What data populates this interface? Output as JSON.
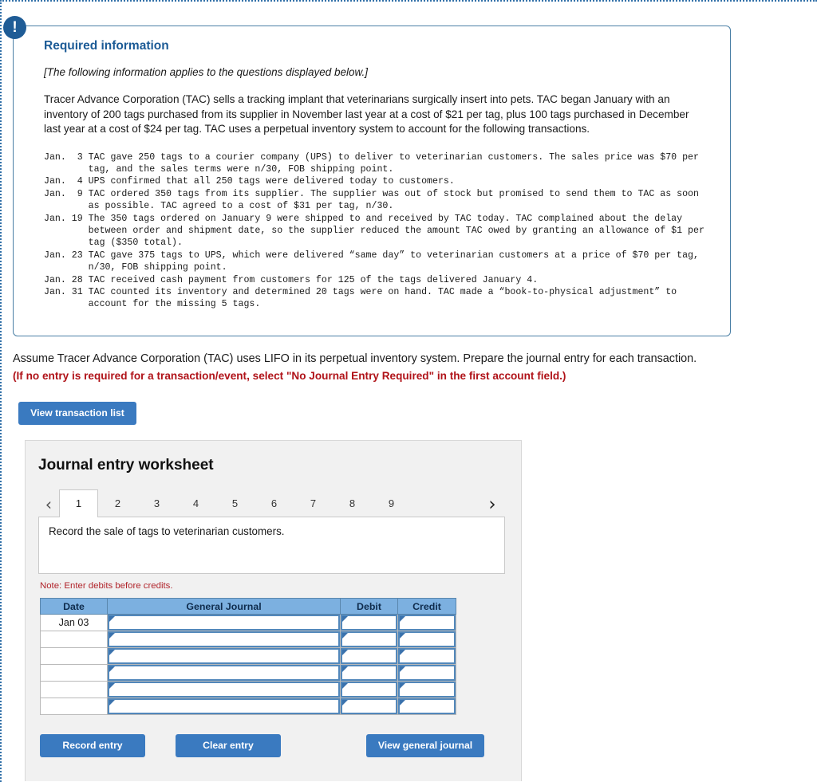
{
  "alert": {
    "icon": "exclamation-icon",
    "glyph": "!"
  },
  "required_info": {
    "title": "Required information",
    "subtitle": "[The following information applies to the questions displayed below.]",
    "body": "Tracer Advance Corporation (TAC) sells a tracking implant that veterinarians surgically insert into pets. TAC began January with an inventory of 200 tags purchased from its supplier in November last year at a cost of $21 per tag, plus 100 tags purchased in December last year at a cost of $24 per tag. TAC uses a perpetual inventory system to account for the following transactions.",
    "transactions_text": "Jan.  3 TAC gave 250 tags to a courier company (UPS) to deliver to veterinarian customers. The sales price was $70 per\n        tag, and the sales terms were n/30, FOB shipping point.\nJan.  4 UPS confirmed that all 250 tags were delivered today to customers.\nJan.  9 TAC ordered 350 tags from its supplier. The supplier was out of stock but promised to send them to TAC as soon\n        as possible. TAC agreed to a cost of $31 per tag, n/30.\nJan. 19 The 350 tags ordered on January 9 were shipped to and received by TAC today. TAC complained about the delay\n        between order and shipment date, so the supplier reduced the amount TAC owed by granting an allowance of $1 per\n        tag ($350 total).\nJan. 23 TAC gave 375 tags to UPS, which were delivered “same day” to veterinarian customers at a price of $70 per tag,\n        n/30, FOB shipping point.\nJan. 28 TAC received cash payment from customers for 125 of the tags delivered January 4.\nJan. 31 TAC counted its inventory and determined 20 tags were on hand. TAC made a “book-to-physical adjustment” to\n        account for the missing 5 tags."
  },
  "instructions": {
    "main": "Assume Tracer Advance Corporation (TAC) uses LIFO in its perpetual inventory system. Prepare the journal entry for each transaction.",
    "warning": "(If no entry is required for a transaction/event, select \"No Journal Entry Required\" in the first account field.)"
  },
  "view_transaction_list_button": "View transaction list",
  "worksheet": {
    "title": "Journal entry worksheet",
    "prev_arrow": "‹",
    "next_arrow": "›",
    "tabs": [
      {
        "label": "1",
        "active": true
      },
      {
        "label": "2",
        "active": false
      },
      {
        "label": "3",
        "active": false
      },
      {
        "label": "4",
        "active": false
      },
      {
        "label": "5",
        "active": false
      },
      {
        "label": "6",
        "active": false
      },
      {
        "label": "7",
        "active": false
      },
      {
        "label": "8",
        "active": false
      },
      {
        "label": "9",
        "active": false
      }
    ],
    "description": "Record the sale of tags to veterinarian customers.",
    "note": "Note: Enter debits before credits.",
    "table": {
      "headers": [
        "Date",
        "General Journal",
        "Debit",
        "Credit"
      ],
      "rows": [
        {
          "date": "Jan 03",
          "general_journal": "",
          "debit": "",
          "credit": ""
        },
        {
          "date": "",
          "general_journal": "",
          "debit": "",
          "credit": ""
        },
        {
          "date": "",
          "general_journal": "",
          "debit": "",
          "credit": ""
        },
        {
          "date": "",
          "general_journal": "",
          "debit": "",
          "credit": ""
        },
        {
          "date": "",
          "general_journal": "",
          "debit": "",
          "credit": ""
        },
        {
          "date": "",
          "general_journal": "",
          "debit": "",
          "credit": ""
        }
      ]
    },
    "actions": {
      "record": "Record entry",
      "clear": "Clear entry",
      "view_journal": "View general journal"
    }
  },
  "colors": {
    "accent_blue": "#3a7ac0",
    "header_blue": "#7cb0e0",
    "title_blue": "#1c5b96",
    "warning_red": "#b01319",
    "note_red": "#b0232a"
  }
}
